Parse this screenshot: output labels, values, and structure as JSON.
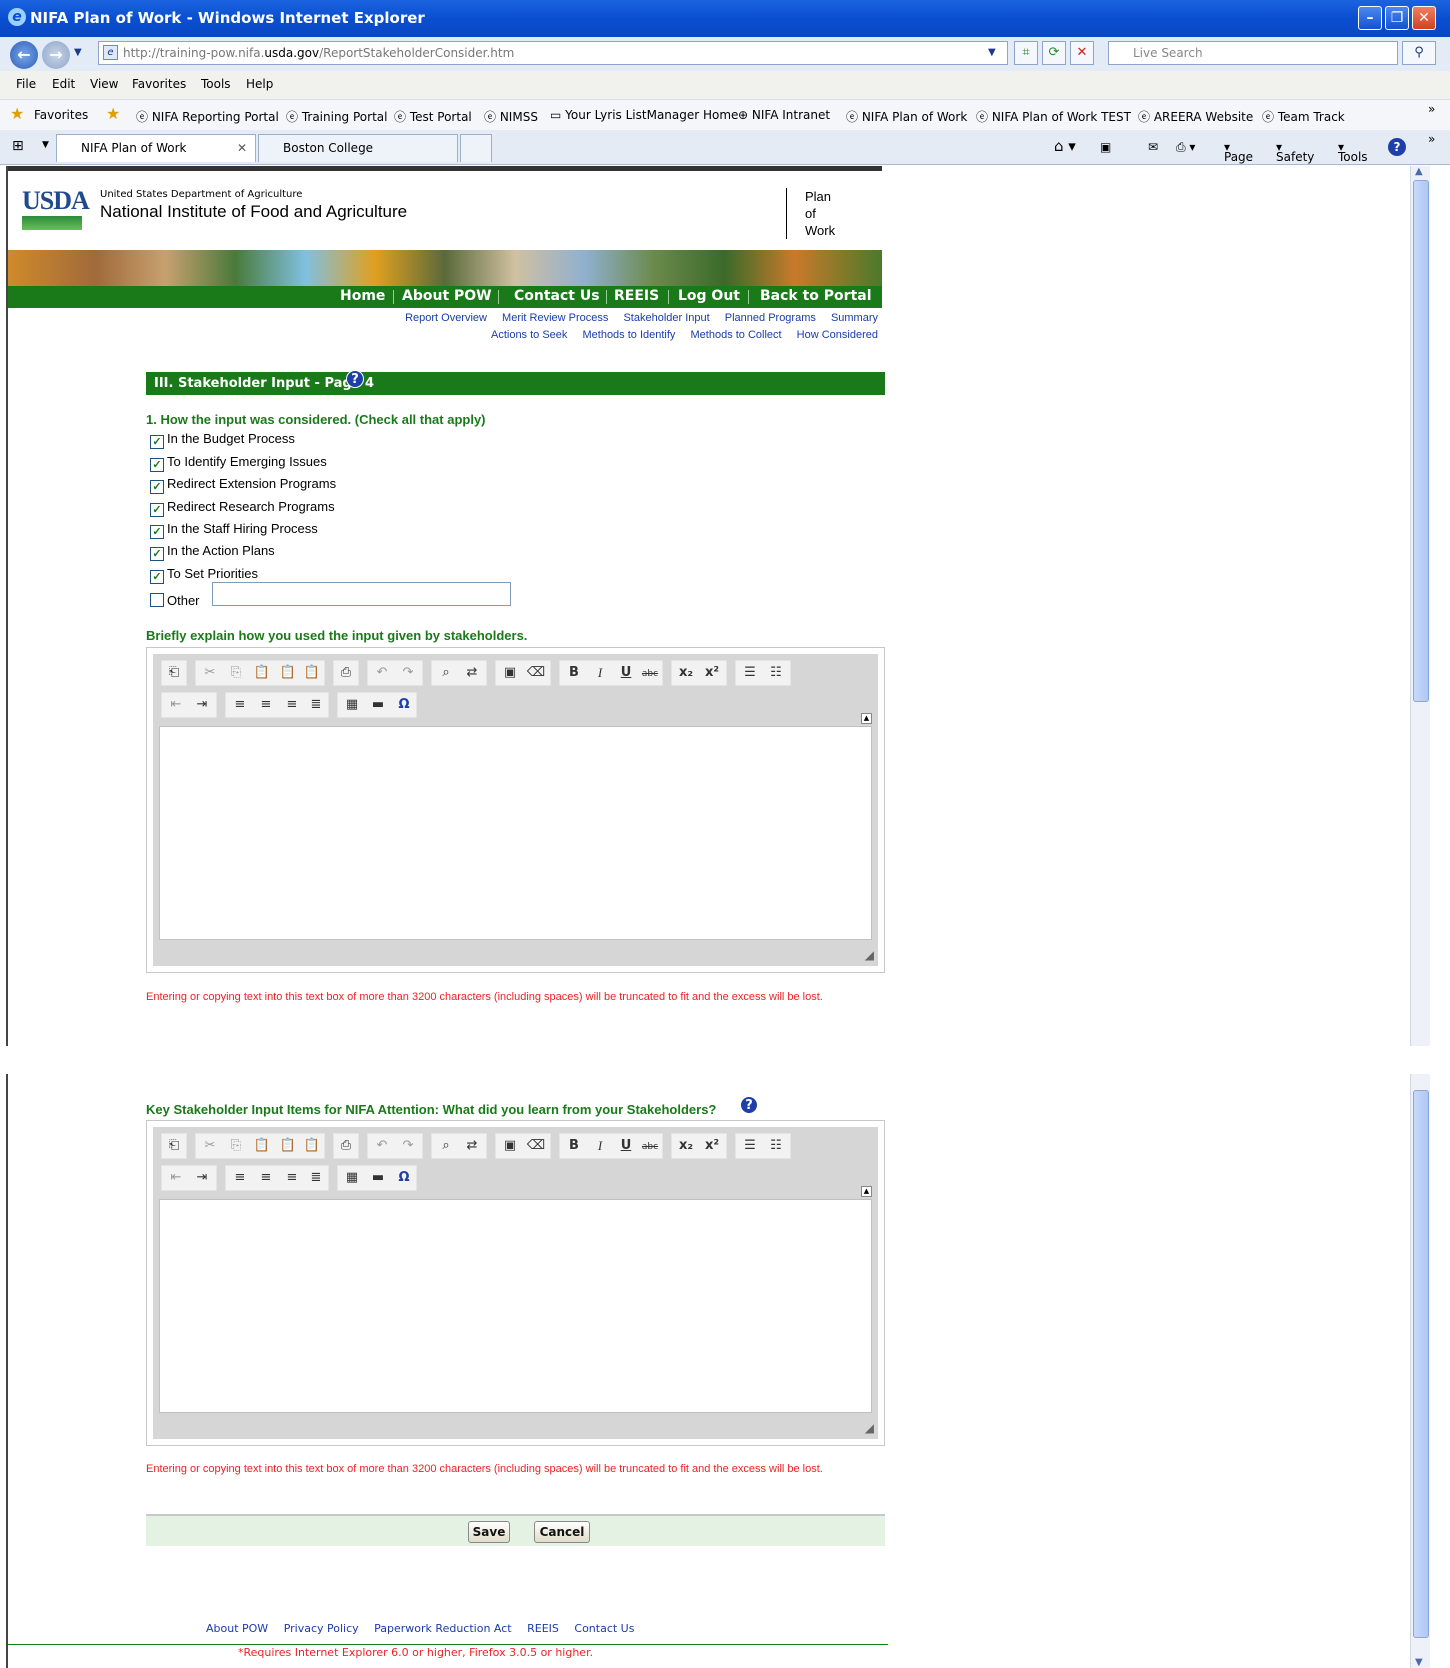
{
  "window": {
    "title": "NIFA Plan of Work - Windows Internet Explorer"
  },
  "address": {
    "prefix": "http://training-pow.nifa.",
    "domain": "usda.gov",
    "path": "/ReportStakeholderConsider.htm"
  },
  "search": {
    "placeholder": "Live Search"
  },
  "menu": [
    "File",
    "Edit",
    "View",
    "Favorites",
    "Tools",
    "Help"
  ],
  "favorites": {
    "label": "Favorites",
    "items": [
      "NIFA Reporting Portal",
      "Training Portal",
      "Test Portal",
      "NIMSS",
      "Your Lyris ListManager Home",
      "NIFA Intranet",
      "NIFA Plan of Work",
      "NIFA Plan of Work TEST",
      "AREERA Website",
      "Team Track"
    ]
  },
  "tabs": [
    "NIFA Plan of Work",
    "Boston College"
  ],
  "commands": [
    "Page",
    "Safety",
    "Tools"
  ],
  "header": {
    "usda": "USDA",
    "dept": "United States Department of Agriculture",
    "institute": "National Institute of Food and Agriculture",
    "pow": [
      "Plan",
      "of",
      "Work"
    ]
  },
  "nav": [
    "Home",
    "About POW",
    "Contact Us",
    "REEIS",
    "Log Out",
    "Back to Portal"
  ],
  "sublinks_row1": [
    "Report Overview",
    "Merit Review Process",
    "Stakeholder Input",
    "Planned Programs",
    "Summary"
  ],
  "sublinks_row2": [
    "Actions to Seek",
    "Methods to Identify",
    "Methods to Collect",
    "How Considered"
  ],
  "section": {
    "title": "III. Stakeholder Input - Page 4"
  },
  "question1": {
    "label": "1. How the input was considered. (Check all that apply)",
    "options": [
      {
        "label": "In the Budget Process",
        "checked": true
      },
      {
        "label": "To Identify Emerging Issues",
        "checked": true
      },
      {
        "label": "Redirect Extension Programs",
        "checked": true
      },
      {
        "label": "Redirect Research Programs",
        "checked": true
      },
      {
        "label": "In the Staff Hiring Process",
        "checked": true
      },
      {
        "label": "In the Action Plans",
        "checked": true
      },
      {
        "label": "To Set Priorities",
        "checked": true
      },
      {
        "label": "Other",
        "checked": false
      }
    ],
    "other_value": ""
  },
  "explain": {
    "label": "Briefly explain how you used the input given by stakeholders."
  },
  "warning": "Entering or copying text into this text box of more than 3200 characters (including spaces) will be truncated to fit and the excess will be lost.",
  "key_items": {
    "label": "Key Stakeholder Input Items for NIFA Attention: What did you learn from your Stakeholders?"
  },
  "buttons": {
    "save": "Save",
    "cancel": "Cancel"
  },
  "footer": {
    "links": [
      "About POW",
      "Privacy Policy",
      "Paperwork Reduction Act",
      "REEIS",
      "Contact Us"
    ],
    "requirements": "*Requires Internet Explorer 6.0 or higher, Firefox 3.0.5 or higher."
  }
}
